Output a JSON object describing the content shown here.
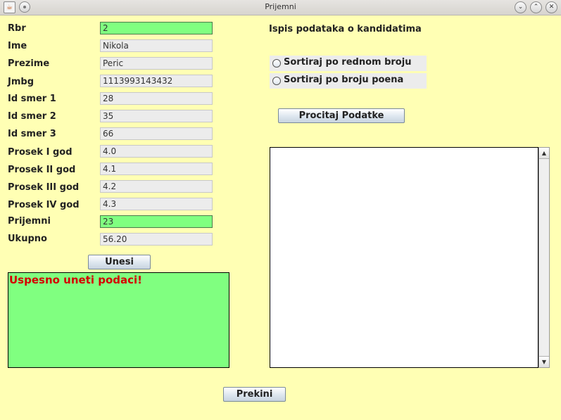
{
  "window": {
    "title": "Prijemni",
    "app_icon": "java-icon",
    "menu_icon": "window-menu-icon",
    "controls": {
      "minimize": "⌄",
      "maximize": "⌃",
      "close": "✕"
    }
  },
  "form": {
    "rbr": {
      "label": "Rbr",
      "value": "2"
    },
    "ime": {
      "label": "Ime",
      "value": "Nikola"
    },
    "prezime": {
      "label": "Prezime",
      "value": "Peric"
    },
    "jmbg": {
      "label": "Jmbg",
      "value": "1113993143432"
    },
    "smer1": {
      "label": "Id smer 1",
      "value": "28"
    },
    "smer2": {
      "label": "Id smer 2",
      "value": "35"
    },
    "smer3": {
      "label": "Id smer 3",
      "value": "66"
    },
    "prosek1": {
      "label": "Prosek I god",
      "value": "4.0"
    },
    "prosek2": {
      "label": "Prosek II god",
      "value": "4.1"
    },
    "prosek3": {
      "label": "Prosek III god",
      "value": "4.2"
    },
    "prosek4": {
      "label": "Prosek IV god",
      "value": "4.3"
    },
    "prijemni": {
      "label": "Prijemni",
      "value": "23"
    },
    "ukupno": {
      "label": "Ukupno",
      "value": "56.20"
    }
  },
  "buttons": {
    "unesi": "Unesi",
    "procitaj": "Procitaj Podatke",
    "prekini": "Prekini"
  },
  "message": "Uspesno uneti podaci!",
  "right_panel": {
    "header": "Ispis podataka o kandidatima",
    "sort_redni": "Sortiraj po rednom broju",
    "sort_poeni": "Sortiraj po broju poena",
    "output_text": ""
  },
  "colors": {
    "background": "#ffffb4",
    "highlight_field": "#80ff80",
    "message_text": "#d40000"
  }
}
